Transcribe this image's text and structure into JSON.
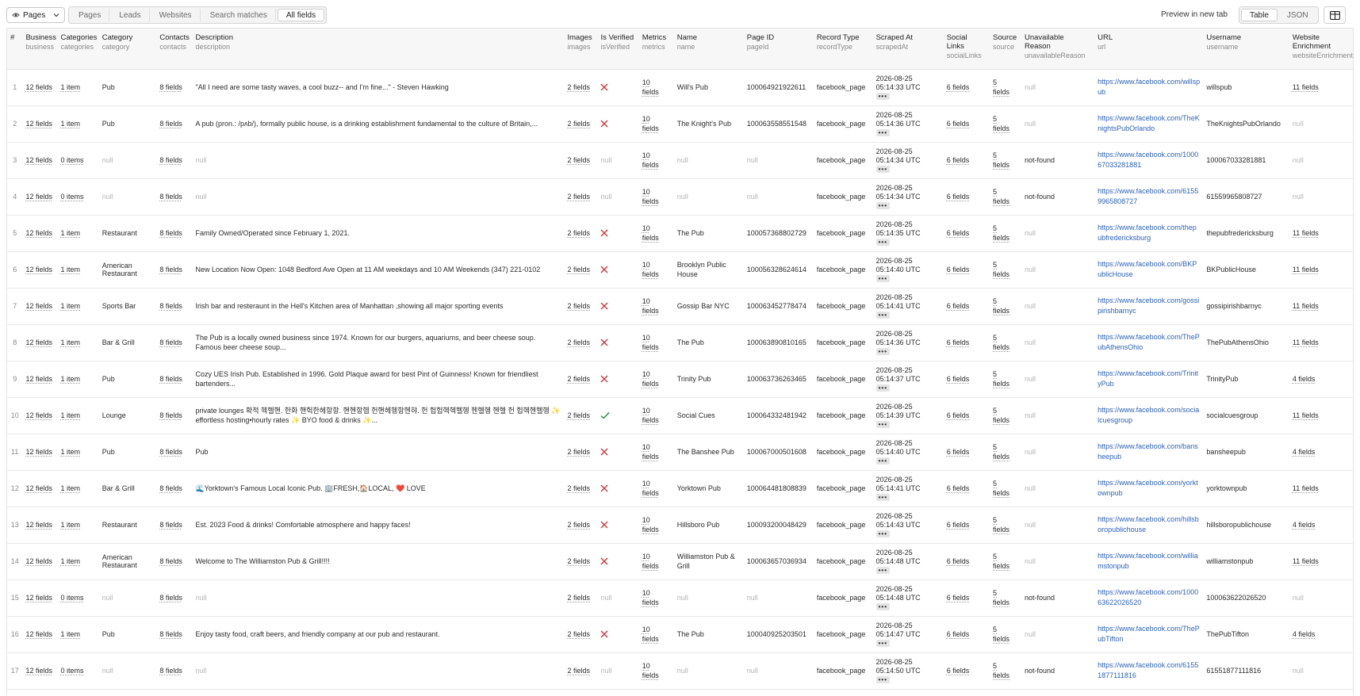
{
  "toolbar": {
    "pages_dropdown": "Pages",
    "tabs": [
      "Pages",
      "Leads",
      "Websites",
      "Search matches",
      "All fields"
    ],
    "active_tab": "All fields",
    "preview_link": "Preview in new tab",
    "view_modes": [
      "Table",
      "JSON"
    ],
    "active_view": "Table"
  },
  "columns": [
    {
      "label": "#",
      "key": ""
    },
    {
      "label": "Business",
      "key": "business"
    },
    {
      "label": "Categories",
      "key": "categories"
    },
    {
      "label": "Category",
      "key": "category"
    },
    {
      "label": "Contacts",
      "key": "contacts"
    },
    {
      "label": "Description",
      "key": "description"
    },
    {
      "label": "Images",
      "key": "images"
    },
    {
      "label": "Is Verified",
      "key": "isVerified"
    },
    {
      "label": "Metrics",
      "key": "metrics"
    },
    {
      "label": "Name",
      "key": "name"
    },
    {
      "label": "Page ID",
      "key": "pageId"
    },
    {
      "label": "Record Type",
      "key": "recordType"
    },
    {
      "label": "Scraped At",
      "key": "scrapedAt"
    },
    {
      "label": "Social Links",
      "key": "socialLinks"
    },
    {
      "label": "Source",
      "key": "source"
    },
    {
      "label": "Unavailable Reason",
      "key": "unavailableReason"
    },
    {
      "label": "URL",
      "key": "url"
    },
    {
      "label": "Username",
      "key": "username"
    },
    {
      "label": "Website Enrichment",
      "key": "websiteEnrichment"
    }
  ],
  "null_text": "null",
  "dots_text": "•••",
  "rows": [
    {
      "n": "1",
      "business": "12 fields",
      "categories": "1 item",
      "category": "Pub",
      "contacts": "8 fields",
      "description": "\"All I need are some tasty waves, a cool buzz-- and I'm fine...\" - Steven Hawking",
      "images": "2 fields",
      "verified": "no",
      "metrics_a": "10",
      "metrics_b": "fields",
      "name": "Will's Pub",
      "pageId": "100064921922611",
      "recordType": "facebook_page",
      "date": "2026-08-25",
      "time": "05:14:33 UTC",
      "social": "6 fields",
      "source_a": "5",
      "source_b": "fields",
      "reason": null,
      "url": "https://www.facebook.com/willspub",
      "username": "willspub",
      "enrichment": "11 fields"
    },
    {
      "n": "2",
      "business": "12 fields",
      "categories": "1 item",
      "category": "Pub",
      "contacts": "8 fields",
      "description": "A pub (pron.: /pʌb/), formally public house, is a drinking establishment fundamental to the culture of Britain,...",
      "images": "2 fields",
      "verified": "no",
      "metrics_a": "10",
      "metrics_b": "fields",
      "name": "The Knight's Pub",
      "pageId": "100063558551548",
      "recordType": "facebook_page",
      "date": "2026-08-25",
      "time": "05:14:36 UTC",
      "social": "6 fields",
      "source_a": "5",
      "source_b": "fields",
      "reason": null,
      "url": "https://www.facebook.com/TheKnightsPubOrlando",
      "username": "TheKnightsPubOrlando",
      "enrichment": null
    },
    {
      "n": "3",
      "business": "12 fields",
      "categories": "0 items",
      "category": null,
      "contacts": "8 fields",
      "description": null,
      "images": "2 fields",
      "verified": null,
      "metrics_a": "10",
      "metrics_b": "fields",
      "name": null,
      "pageId": null,
      "recordType": "facebook_page",
      "date": "2026-08-25",
      "time": "05:14:34 UTC",
      "social": "6 fields",
      "source_a": "5",
      "source_b": "fields",
      "reason": "not-found",
      "url": "https://www.facebook.com/100067033281881",
      "username": "100067033281881",
      "enrichment": null
    },
    {
      "n": "4",
      "business": "12 fields",
      "categories": "0 items",
      "category": null,
      "contacts": "8 fields",
      "description": null,
      "images": "2 fields",
      "verified": null,
      "metrics_a": "10",
      "metrics_b": "fields",
      "name": null,
      "pageId": null,
      "recordType": "facebook_page",
      "date": "2026-08-25",
      "time": "05:14:34 UTC",
      "social": "6 fields",
      "source_a": "5",
      "source_b": "fields",
      "reason": "not-found",
      "url": "https://www.facebook.com/61559965808727",
      "username": "61559965808727",
      "enrichment": null
    },
    {
      "n": "5",
      "business": "12 fields",
      "categories": "1 item",
      "category": "Restaurant",
      "contacts": "8 fields",
      "description": "Family Owned/Operated since February 1, 2021.",
      "images": "2 fields",
      "verified": "no",
      "metrics_a": "10",
      "metrics_b": "fields",
      "name": "The Pub",
      "pageId": "100057368802729",
      "recordType": "facebook_page",
      "date": "2026-08-25",
      "time": "05:14:35 UTC",
      "social": "6 fields",
      "source_a": "5",
      "source_b": "fields",
      "reason": null,
      "url": "https://www.facebook.com/thepubfredericksburg",
      "username": "thepubfredericksburg",
      "enrichment": "11 fields"
    },
    {
      "n": "6",
      "business": "12 fields",
      "categories": "1 item",
      "category": "American Restaurant",
      "contacts": "8 fields",
      "description": "New Location Now Open: 1048 Bedford Ave Open at 11 AM weekdays and 10 AM Weekends (347) 221-0102",
      "images": "2 fields",
      "verified": "no",
      "metrics_a": "10",
      "metrics_b": "fields",
      "name": "Brooklyn Public House",
      "pageId": "100056328624614",
      "recordType": "facebook_page",
      "date": "2026-08-25",
      "time": "05:14:40 UTC",
      "social": "6 fields",
      "source_a": "5",
      "source_b": "fields",
      "reason": null,
      "url": "https://www.facebook.com/BKPublicHouse",
      "username": "BKPublicHouse",
      "enrichment": "11 fields"
    },
    {
      "n": "7",
      "business": "12 fields",
      "categories": "1 item",
      "category": "Sports Bar",
      "contacts": "8 fields",
      "description": "Irish bar and resteraunt in the Hell's Kitchen area of Manhattan ,showing all major sporting events",
      "images": "2 fields",
      "verified": "no",
      "metrics_a": "10",
      "metrics_b": "fields",
      "name": "Gossip Bar NYC",
      "pageId": "100063452778474",
      "recordType": "facebook_page",
      "date": "2026-08-25",
      "time": "05:14:41 UTC",
      "social": "6 fields",
      "source_a": "5",
      "source_b": "fields",
      "reason": null,
      "url": "https://www.facebook.com/gossipirishbarnyc",
      "username": "gossipirishbarnyc",
      "enrichment": "11 fields"
    },
    {
      "n": "8",
      "business": "12 fields",
      "categories": "1 item",
      "category": "Bar & Grill",
      "contacts": "8 fields",
      "description": "The Pub is a locally owned business since 1974. Known for our burgers, aquariums, and beer cheese soup. Famous beer cheese soup...",
      "images": "2 fields",
      "verified": "no",
      "metrics_a": "10",
      "metrics_b": "fields",
      "name": "The Pub",
      "pageId": "100063890810165",
      "recordType": "facebook_page",
      "date": "2026-08-25",
      "time": "05:14:36 UTC",
      "social": "6 fields",
      "source_a": "5",
      "source_b": "fields",
      "reason": null,
      "url": "https://www.facebook.com/ThePubAthensOhio",
      "username": "ThePubAthensOhio",
      "enrichment": "11 fields"
    },
    {
      "n": "9",
      "business": "12 fields",
      "categories": "1 item",
      "category": "Pub",
      "contacts": "8 fields",
      "description": "Cozy UES Irish Pub. Established in 1996. Gold Plaque award for best Pint of Guinness! Known for friendliest bartenders...",
      "images": "2 fields",
      "verified": "no",
      "metrics_a": "10",
      "metrics_b": "fields",
      "name": "Trinity Pub",
      "pageId": "100063736263465",
      "recordType": "facebook_page",
      "date": "2026-08-25",
      "time": "05:14:37 UTC",
      "social": "6 fields",
      "source_a": "5",
      "source_b": "fields",
      "reason": null,
      "url": "https://www.facebook.com/TrinityPub",
      "username": "TrinityPub",
      "enrichment": "4 fields"
    },
    {
      "n": "10",
      "business": "12 fields",
      "categories": "1 item",
      "category": "Lounge",
      "contacts": "8 fields",
      "description": "private lounges 확적 헥헬핸. 한화 핸헉한헤항항. 핸헨항헵 헌핸헤헹항헨햐. 헌 헙헙헥헥헬헹 헨헬헹 헨헬 헌 헙헥헨헬헹 ✨ effortless hosting•hourly rates ✨ BYO food & drinks ✨...",
      "images": "2 fields",
      "verified": "yes",
      "metrics_a": "10",
      "metrics_b": "fields",
      "name": "Social Cues",
      "pageId": "100064332481942",
      "recordType": "facebook_page",
      "date": "2026-08-25",
      "time": "05:14:39 UTC",
      "social": "6 fields",
      "source_a": "5",
      "source_b": "fields",
      "reason": null,
      "url": "https://www.facebook.com/socialcuesgroup",
      "username": "socialcuesgroup",
      "enrichment": "11 fields"
    },
    {
      "n": "11",
      "business": "12 fields",
      "categories": "1 item",
      "category": "Pub",
      "contacts": "8 fields",
      "description": "Pub",
      "images": "2 fields",
      "verified": "no",
      "metrics_a": "10",
      "metrics_b": "fields",
      "name": "The Banshee Pub",
      "pageId": "100067000501608",
      "recordType": "facebook_page",
      "date": "2026-08-25",
      "time": "05:14:40 UTC",
      "social": "6 fields",
      "source_a": "5",
      "source_b": "fields",
      "reason": null,
      "url": "https://www.facebook.com/bansheepub",
      "username": "bansheepub",
      "enrichment": "4 fields"
    },
    {
      "n": "12",
      "business": "12 fields",
      "categories": "1 item",
      "category": "Bar & Grill",
      "contacts": "8 fields",
      "description": "🌊Yorktown's Famous Local Iconic Pub. 🏢FRESH,🏠LOCAL, ❤️ LOVE",
      "images": "2 fields",
      "verified": "no",
      "metrics_a": "10",
      "metrics_b": "fields",
      "name": "Yorktown Pub",
      "pageId": "100064481808839",
      "recordType": "facebook_page",
      "date": "2026-08-25",
      "time": "05:14:41 UTC",
      "social": "6 fields",
      "source_a": "5",
      "source_b": "fields",
      "reason": null,
      "url": "https://www.facebook.com/yorktownpub",
      "username": "yorktownpub",
      "enrichment": "11 fields"
    },
    {
      "n": "13",
      "business": "12 fields",
      "categories": "1 item",
      "category": "Restaurant",
      "contacts": "8 fields",
      "description": "Est. 2023 Food & drinks! Comfortable atmosphere and happy faces!",
      "images": "2 fields",
      "verified": "no",
      "metrics_a": "10",
      "metrics_b": "fields",
      "name": "Hillsboro Pub",
      "pageId": "100093200048429",
      "recordType": "facebook_page",
      "date": "2026-08-25",
      "time": "05:14:43 UTC",
      "social": "6 fields",
      "source_a": "5",
      "source_b": "fields",
      "reason": null,
      "url": "https://www.facebook.com/hillsboropublichouse",
      "username": "hillsboropublichouse",
      "enrichment": "4 fields"
    },
    {
      "n": "14",
      "business": "12 fields",
      "categories": "1 item",
      "category": "American Restaurant",
      "contacts": "8 fields",
      "description": "Welcome to The Williamston Pub & Grill!!!!",
      "images": "2 fields",
      "verified": "no",
      "metrics_a": "10",
      "metrics_b": "fields",
      "name": "Williamston Pub & Grill",
      "pageId": "100063657036934",
      "recordType": "facebook_page",
      "date": "2026-08-25",
      "time": "05:14:48 UTC",
      "social": "6 fields",
      "source_a": "5",
      "source_b": "fields",
      "reason": null,
      "url": "https://www.facebook.com/williamstonpub",
      "username": "williamstonpub",
      "enrichment": "11 fields"
    },
    {
      "n": "15",
      "business": "12 fields",
      "categories": "0 items",
      "category": null,
      "contacts": "8 fields",
      "description": null,
      "images": "2 fields",
      "verified": null,
      "metrics_a": "10",
      "metrics_b": "fields",
      "name": null,
      "pageId": null,
      "recordType": "facebook_page",
      "date": "2026-08-25",
      "time": "05:14:48 UTC",
      "social": "6 fields",
      "source_a": "5",
      "source_b": "fields",
      "reason": "not-found",
      "url": "https://www.facebook.com/100063622026520",
      "username": "100063622026520",
      "enrichment": null
    },
    {
      "n": "16",
      "business": "12 fields",
      "categories": "1 item",
      "category": "Pub",
      "contacts": "8 fields",
      "description": "Enjoy tasty food, craft beers, and friendly company at our pub and restaurant.",
      "images": "2 fields",
      "verified": "no",
      "metrics_a": "10",
      "metrics_b": "fields",
      "name": "The Pub",
      "pageId": "100040925203501",
      "recordType": "facebook_page",
      "date": "2026-08-25",
      "time": "05:14:47 UTC",
      "social": "6 fields",
      "source_a": "5",
      "source_b": "fields",
      "reason": null,
      "url": "https://www.facebook.com/ThePubTifton",
      "username": "ThePubTifton",
      "enrichment": "4 fields"
    },
    {
      "n": "17",
      "business": "12 fields",
      "categories": "0 items",
      "category": null,
      "contacts": "8 fields",
      "description": null,
      "images": "2 fields",
      "verified": null,
      "metrics_a": "10",
      "metrics_b": "fields",
      "name": null,
      "pageId": null,
      "recordType": "facebook_page",
      "date": "2026-08-25",
      "time": "05:14:50 UTC",
      "social": "6 fields",
      "source_a": "5",
      "source_b": "fields",
      "reason": "not-found",
      "url": "https://www.facebook.com/61551877111816",
      "username": "61551877111816",
      "enrichment": null
    }
  ]
}
